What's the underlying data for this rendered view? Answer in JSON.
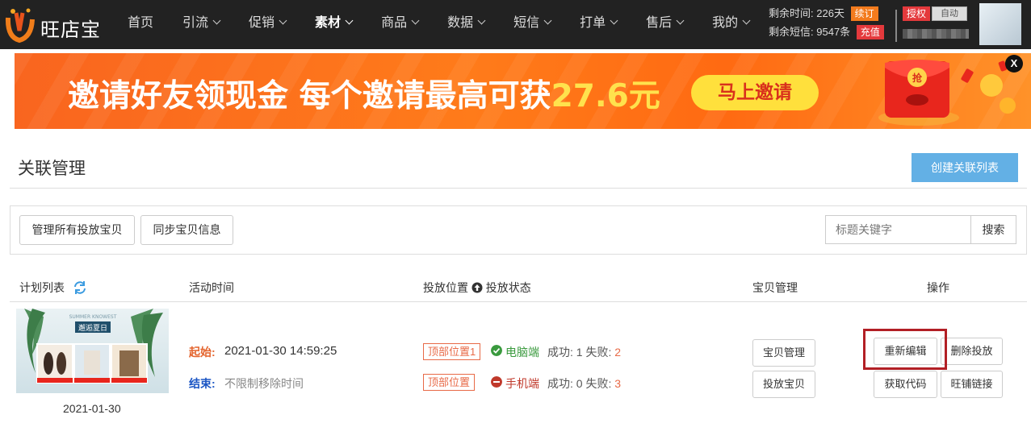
{
  "brand": {
    "name": "旺店宝"
  },
  "nav": {
    "items": [
      {
        "label": "首页",
        "dropdown": false,
        "active": false
      },
      {
        "label": "引流",
        "dropdown": true,
        "active": false
      },
      {
        "label": "促销",
        "dropdown": true,
        "active": false
      },
      {
        "label": "素材",
        "dropdown": true,
        "active": true
      },
      {
        "label": "商品",
        "dropdown": true,
        "active": false
      },
      {
        "label": "数据",
        "dropdown": true,
        "active": false
      },
      {
        "label": "短信",
        "dropdown": true,
        "active": false
      },
      {
        "label": "打单",
        "dropdown": true,
        "active": false
      },
      {
        "label": "售后",
        "dropdown": true,
        "active": false
      },
      {
        "label": "我的",
        "dropdown": true,
        "active": false
      }
    ]
  },
  "account": {
    "time_label": "剩余时间:",
    "time_value": "226天",
    "renew_label": "续订",
    "sms_label": "剩余短信:",
    "sms_value": "9547条",
    "recharge_label": "充值",
    "auth_label": "授权",
    "auth_chip": "自动"
  },
  "banner": {
    "text_main": "邀请好友领现金 每个邀请最高可获",
    "text_amount": "27.6元",
    "button_label": "马上邀请",
    "close_label": "X",
    "envelope_glyph": "抢"
  },
  "page": {
    "title": "关联管理",
    "create_button": "创建关联列表"
  },
  "toolbar": {
    "manage_all_button": "管理所有投放宝贝",
    "sync_button": "同步宝贝信息",
    "search_placeholder": "标题关键字",
    "search_button": "搜索"
  },
  "table": {
    "headers": {
      "plan_list": "计划列表",
      "activity_time": "活动时间",
      "position": "投放位置",
      "status": "投放状态",
      "item_manage": "宝贝管理",
      "operation": "操作"
    },
    "rows": [
      {
        "thumbnail_caption": "SUMMER KNOWEST",
        "thumbnail_title": "邂逅夏日",
        "date": "2021-01-30",
        "start_label": "起始:",
        "start_value": "2021-01-30 14:59:25",
        "end_label": "结束:",
        "end_value": "不限制移除时间",
        "placements": [
          {
            "position_tag": "顶部位置1",
            "platform": "电脑端",
            "status": "ok",
            "success_label": "成功:",
            "success": "1",
            "fail_label": "失败:",
            "fail": "2"
          },
          {
            "position_tag": "顶部位置",
            "platform": "手机端",
            "status": "blocked",
            "success_label": "成功:",
            "success": "0",
            "fail_label": "失败:",
            "fail": "3"
          }
        ],
        "item_buttons": {
          "manage": "宝贝管理",
          "deliver": "投放宝贝"
        },
        "actions": {
          "reedit": "重新编辑",
          "delete": "删除投放",
          "get_code": "获取代码",
          "shop_link": "旺铺链接"
        }
      }
    ]
  },
  "colors": {
    "nav_bg": "#222222",
    "accent_blue": "#63b0e5",
    "renew_orange": "#f37b1d",
    "recharge_red": "#e4393c",
    "start_orange": "#e4642d",
    "end_blue": "#1a55c4",
    "ok_green": "#3a9a3e",
    "blocked_red": "#c0392b",
    "highlight_box": "#b21f25"
  }
}
